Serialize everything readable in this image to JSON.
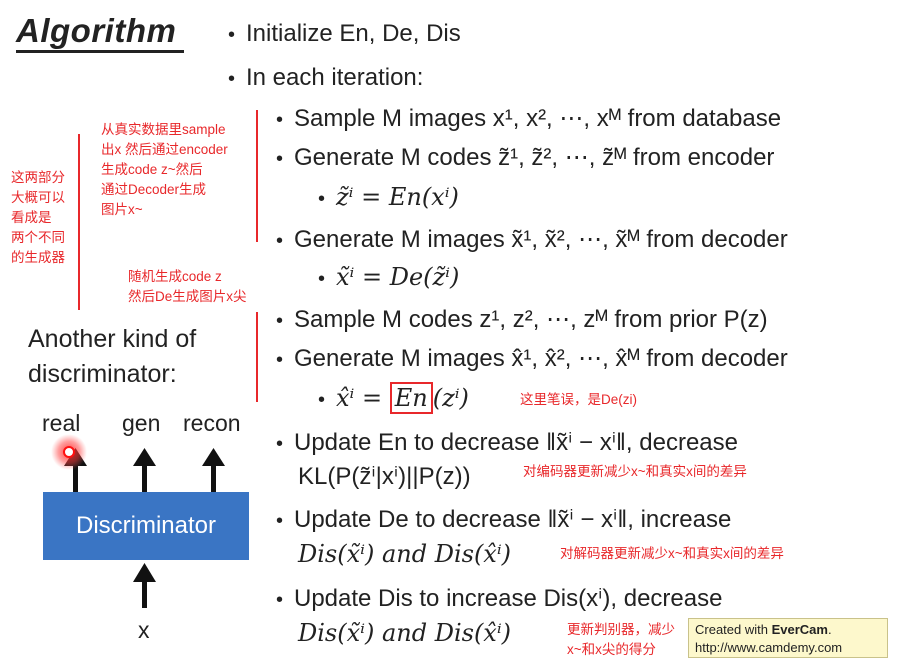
{
  "title": "Algorithm",
  "bullets": {
    "init": "Initialize En, De, Dis",
    "iter": "In each iteration:",
    "s1": "Sample M images x¹, x², ⋯, xᴹ from database",
    "s2": "Generate M codes z̃¹, z̃², ⋯, z̃ᴹ from encoder",
    "s2a": "z̃ⁱ = En(xⁱ)",
    "s3": "Generate M images x̃¹, x̃², ⋯, x̃ᴹ from decoder",
    "s3a": "x̃ⁱ = De(z̃ⁱ)",
    "s4": "Sample M codes z¹, z², ⋯, zᴹ from prior P(z)",
    "s5": "Generate M images x̂¹, x̂², ⋯, x̂ᴹ from decoder",
    "s5a_pre": "x̂ⁱ = ",
    "s5a_box": "En",
    "s5a_post": "(zⁱ)",
    "s6a": "Update En to decrease ‖x̃ⁱ − xⁱ‖, decrease",
    "s6b": "KL(P(z̃ⁱ|xⁱ)||P(z))",
    "s7a": "Update De to decrease ‖x̃ⁱ − xⁱ‖, increase",
    "s7b": "Dis(x̃ⁱ) and Dis(x̂ⁱ)",
    "s8a": "Update Dis to increase Dis(xⁱ), decrease",
    "s8b": "Dis(x̃ⁱ) and Dis(x̂ⁱ)"
  },
  "side": {
    "another_1": "Another kind of",
    "another_2": "discriminator:",
    "real": "real",
    "gen": "gen",
    "recon": "recon",
    "disc": "Discriminator",
    "x": "x"
  },
  "notes": {
    "n1": [
      "从真实数据里sample",
      "出x 然后通过encoder",
      "生成code z~然后",
      "通过Decoder生成",
      "图片x~"
    ],
    "n2": [
      "这两部分",
      "大概可以",
      "看成是",
      "两个不同",
      "的生成器"
    ],
    "n3": [
      "随机生成code z",
      "然后De生成图片x尖"
    ],
    "n4": "这里笔误，是De(zi)",
    "n5": "对编码器更新减少x~和真实x间的差异",
    "n6": "对解码器更新减少x~和真实x间的差异",
    "n7": [
      "更新判别器，减少",
      "x~和x尖的得分"
    ]
  },
  "watermark": {
    "line1_pre": "Created with ",
    "line1_brand": "EverCam",
    "line1_post": ".",
    "line2": "http://www.camdemy.com"
  },
  "colors": {
    "accent": "#e8282b",
    "disc": "#3a75c4"
  }
}
